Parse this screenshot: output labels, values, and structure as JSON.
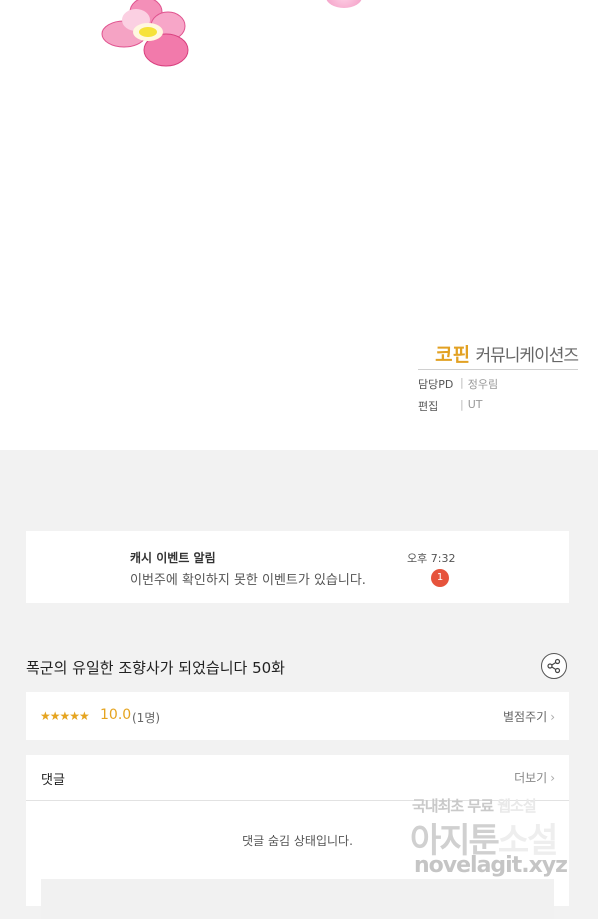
{
  "credits": {
    "studio_a": "코핀",
    "studio_b": "커뮤니케이션즈",
    "pd_label": "담당PD",
    "pd_value": "정우림",
    "edit_label": "편집",
    "edit_value": "UT",
    "separator": "|"
  },
  "notice": {
    "title": "캐시 이벤트 알림",
    "message": "이번주에 확인하지 못한 이벤트가 있습니다.",
    "time": "오후 7:32",
    "badge": "1"
  },
  "episode": {
    "title": "폭군의 유일한 조향사가 되었습니다 50화"
  },
  "rating": {
    "stars": "★★★★★",
    "score": "10.0",
    "votes": "(1명)",
    "rate_link": "별점주기",
    "score_value": 10.0,
    "star_color": "#e5a420"
  },
  "comments": {
    "title": "댓글",
    "more": "더보기",
    "hidden_msg": "댓글 숨김 상태입니다."
  },
  "watermark": {
    "line1_a": "국내최초 무료 ",
    "line1_b": "웹소설",
    "line2_a": "아지툰",
    "line2_b": "소설",
    "line3": "novelagit.xyz"
  },
  "icons": {
    "chevron": "›",
    "share": "share-icon",
    "flower": "flower-icon"
  }
}
